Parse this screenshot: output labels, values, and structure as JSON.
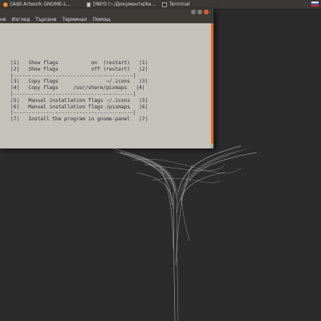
{
  "taskbar": {
    "tasks": [
      {
        "label": "[Add Artwork GNOME-L...",
        "icon": "firefox-icon"
      },
      {
        "label": "[INFO (~/Документи/ke...",
        "icon": "document-icon"
      },
      {
        "label": "Terminal",
        "icon": "terminal-icon"
      }
    ]
  },
  "terminal": {
    "menu": [
      "не",
      "Изглед",
      "Търсене",
      "Терминал",
      "Помощ"
    ],
    "lines": [
      "|1|   Show flags           on  (restart)   |1|",
      "|2|   Show flags           off (restart)   |2|",
      "|----------------------------------------|",
      "|3|   Copy flags                ~/.icons   |3|",
      "|4|   Copy flags     /usr/share/pixmaps   |4|",
      "|----------------------------------------|",
      "|5|   Manual installation flags ~/.icons   |5|",
      "|6|   Manual installation flags /pixmaps   |6|",
      "|----------------------------------------|",
      "|7|   Install the program in gnome-panel   |7|"
    ],
    "accent_color": "#e06a20"
  }
}
